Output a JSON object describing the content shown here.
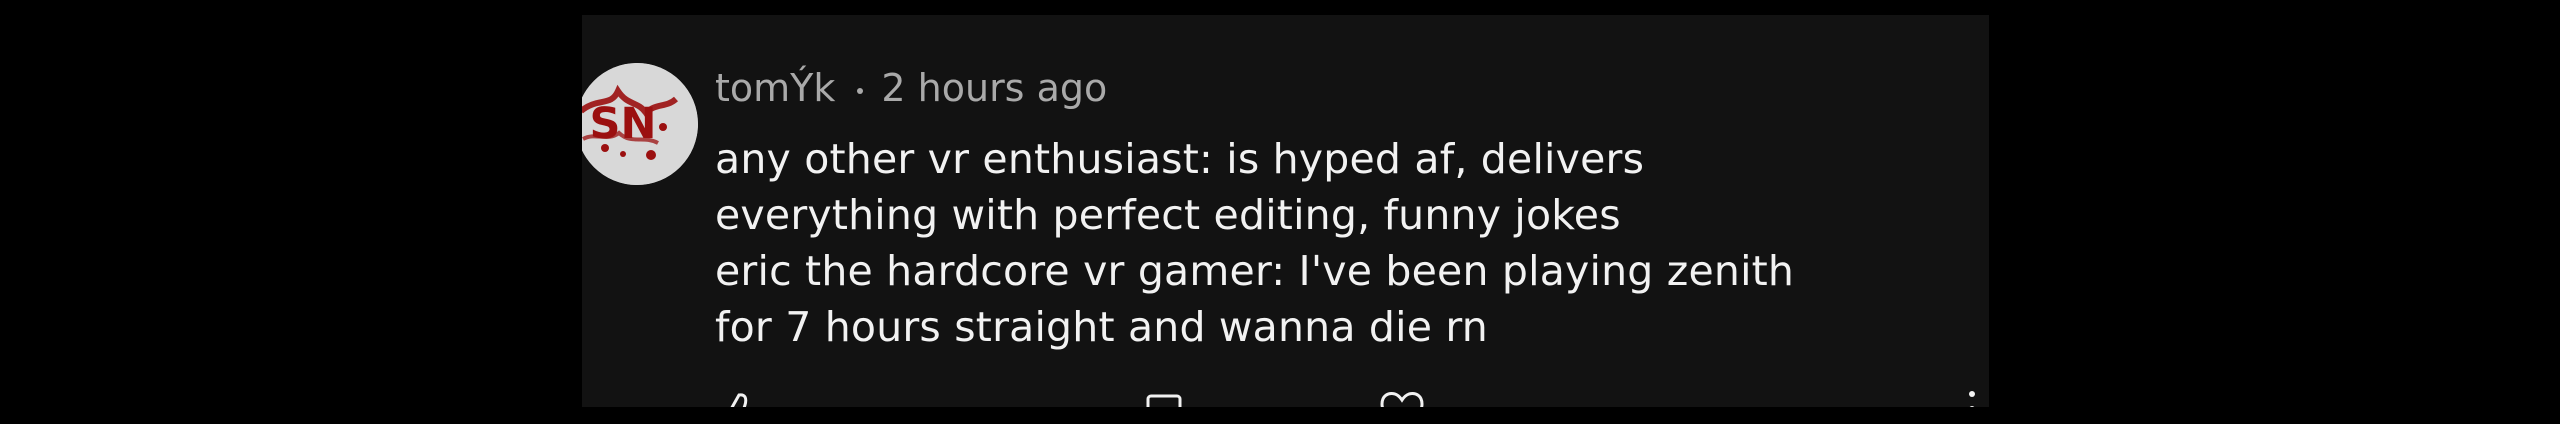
{
  "comment": {
    "author": "tomÝk",
    "timestamp": "2 hours ago",
    "lines": [
      "any other vr enthusiast: is hyped af, delivers",
      "everything with perfect editing, funny jokes",
      "eric the hardcore vr gamer: I've been playing zenith",
      "for 7 hours straight and wanna die rn"
    ],
    "avatar_text": "SN"
  },
  "actions": {
    "like_icon": "thumb-up-icon",
    "reply_icon": "reply-icon",
    "heart_icon": "heart-icon",
    "more_icon": "more-vertical-icon"
  },
  "colors": {
    "page_background": "#000000",
    "card_background": "#121212",
    "primary_text": "#f2f2f2",
    "secondary_text": "#a9a9a9",
    "avatar_red": "#9b1010"
  }
}
